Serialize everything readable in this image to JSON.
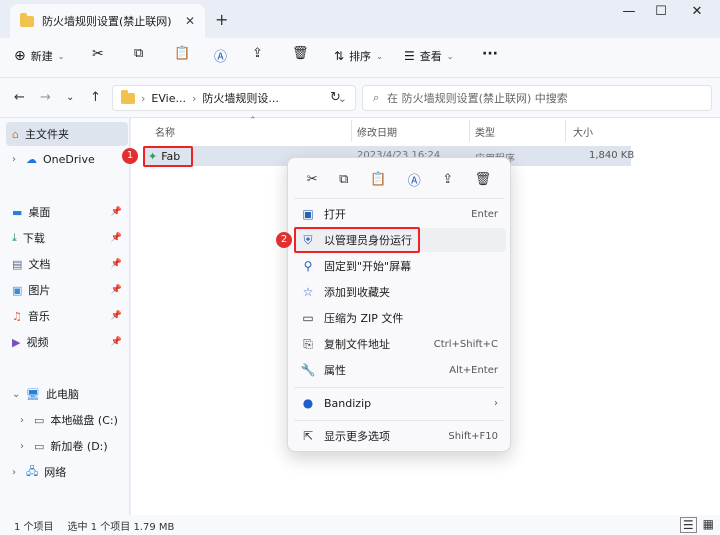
{
  "window": {
    "tab_title": "防火墙规则设置(禁止联网)",
    "new_tab": "+",
    "min": "—",
    "max": "☐",
    "close": "✕"
  },
  "toolbar": {
    "new_label": "新建",
    "sort_label": "排序",
    "view_label": "查看",
    "more": "···"
  },
  "nav": {
    "address_segments": [
      "EVie...",
      "防火墙规则设..."
    ],
    "search_placeholder": "在 防火墙规则设置(禁止联网) 中搜索"
  },
  "sidebar": {
    "items": [
      {
        "label": "主文件夹"
      },
      {
        "label": "OneDrive"
      },
      {
        "label": "桌面"
      },
      {
        "label": "下载"
      },
      {
        "label": "文档"
      },
      {
        "label": "图片"
      },
      {
        "label": "音乐"
      },
      {
        "label": "视频"
      },
      {
        "label": "此电脑"
      },
      {
        "label": "本地磁盘 (C:)"
      },
      {
        "label": "新加卷 (D:)"
      },
      {
        "label": "网络"
      }
    ]
  },
  "columns": {
    "name": "名称",
    "date": "修改日期",
    "type": "类型",
    "size": "大小"
  },
  "file": {
    "name": "Fab",
    "date": "2023/4/23 16:24",
    "type": "应用程序",
    "size": "1,840 KB"
  },
  "context_menu": {
    "items": [
      {
        "label": "打开",
        "shortcut": "Enter"
      },
      {
        "label": "以管理员身份运行",
        "shortcut": ""
      },
      {
        "label": "固定到\"开始\"屏幕",
        "shortcut": ""
      },
      {
        "label": "添加到收藏夹",
        "shortcut": ""
      },
      {
        "label": "压缩为 ZIP 文件",
        "shortcut": ""
      },
      {
        "label": "复制文件地址",
        "shortcut": "Ctrl+Shift+C"
      },
      {
        "label": "属性",
        "shortcut": "Alt+Enter"
      },
      {
        "label": "Bandizip",
        "shortcut": "›"
      },
      {
        "label": "显示更多选项",
        "shortcut": "Shift+F10"
      }
    ]
  },
  "annotations": {
    "step1": "1",
    "step2": "2"
  },
  "status": {
    "count": "1 个项目",
    "selected": "选中 1 个项目  1.79 MB"
  },
  "colors": {
    "accent": "#2b5fb6",
    "highlight_red": "#e22222",
    "folder": "#f2c14e"
  }
}
